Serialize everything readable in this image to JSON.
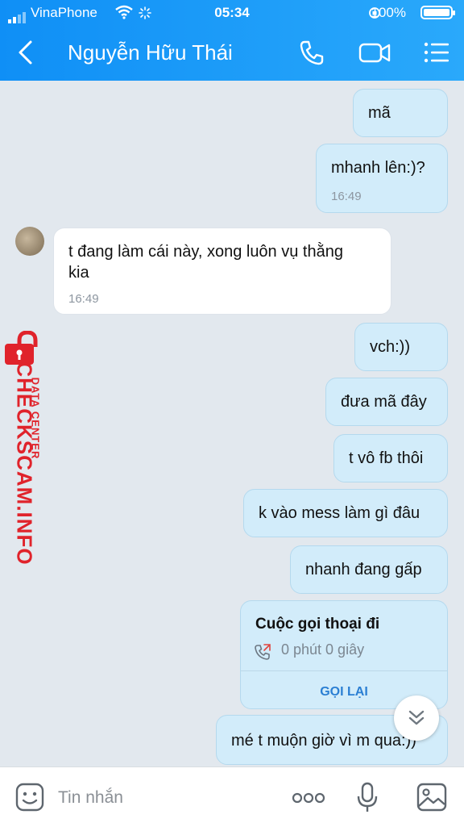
{
  "status_bar": {
    "carrier": "VinaPhone",
    "time": "05:34",
    "battery": "100%"
  },
  "header": {
    "title": "Nguyễn Hữu Thái"
  },
  "messages": [
    {
      "dir": "out",
      "text": "mã"
    },
    {
      "dir": "out",
      "text": "mhanh lên:)?",
      "time": "16:49"
    },
    {
      "dir": "in",
      "text_line1": "t đang làm cái này, xong luôn vụ thằng",
      "text_line2": "kia",
      "time": "16:49"
    },
    {
      "dir": "out",
      "text": "vch:))"
    },
    {
      "dir": "out",
      "text": "đưa mã đây"
    },
    {
      "dir": "out",
      "text": "t vô fb thôi"
    },
    {
      "dir": "out",
      "text": "k vào mess làm gì đâu"
    },
    {
      "dir": "out",
      "text": "nhanh đang gấp"
    },
    {
      "dir": "out",
      "text": "mé t muộn giờ vì m qua:))"
    }
  ],
  "call_card": {
    "title": "Cuộc gọi thoại đi",
    "duration": "0 phút 0 giây",
    "action": "GỌI LẠI"
  },
  "watermark": {
    "brand": "CHECKSCAM.INFO",
    "sub": "DATA CENTER"
  },
  "composer": {
    "placeholder": "Tin nhắn"
  },
  "colors": {
    "header": "#1a9af8",
    "bubble_out": "#d2ecfa",
    "watermark": "#e0232b"
  }
}
